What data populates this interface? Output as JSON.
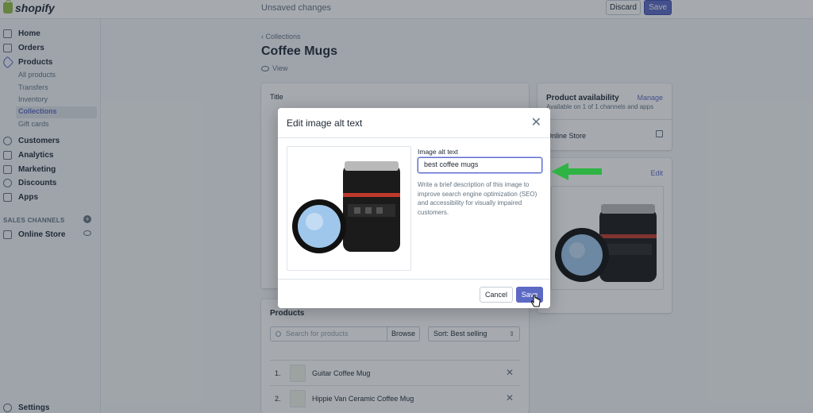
{
  "topbar": {
    "brand": "shopify",
    "status": "Unsaved changes",
    "discard_label": "Discard",
    "save_label": "Save"
  },
  "sidebar": {
    "items": [
      {
        "label": "Home",
        "icon": "home-icon"
      },
      {
        "label": "Orders",
        "icon": "orders-icon"
      },
      {
        "label": "Products",
        "icon": "tag-icon"
      }
    ],
    "product_subitems": [
      "All products",
      "Transfers",
      "Inventory",
      "Collections",
      "Gift cards"
    ],
    "active_subitem": "Collections",
    "items2": [
      {
        "label": "Customers",
        "icon": "person-icon"
      },
      {
        "label": "Analytics",
        "icon": "bar-chart-icon"
      },
      {
        "label": "Marketing",
        "icon": "megaphone-icon"
      },
      {
        "label": "Discounts",
        "icon": "discount-icon"
      },
      {
        "label": "Apps",
        "icon": "apps-icon"
      }
    ],
    "channels_title": "SALES CHANNELS",
    "channel": "Online Store",
    "settings": "Settings"
  },
  "page": {
    "back_link": "Collections",
    "title": "Coffee Mugs",
    "view_link": "View"
  },
  "main_card": {
    "title_label": "Title"
  },
  "products": {
    "title": "Products",
    "search_placeholder": "Search for products",
    "browse_label": "Browse",
    "sort_label": "Sort: Best selling",
    "rows": [
      {
        "num": "1.",
        "name": "Guitar Coffee Mug"
      },
      {
        "num": "2.",
        "name": "Hippie Van Ceramic Coffee Mug"
      }
    ]
  },
  "availability": {
    "title": "Product availability",
    "manage": "Manage",
    "desc": "Available on 1 of 1 channels and apps",
    "store": "Online Store"
  },
  "image_card": {
    "edit": "Edit"
  },
  "modal": {
    "title": "Edit image alt text",
    "alt_label": "Image alt text",
    "alt_value": "best coffee mugs",
    "help_text": "Write a brief description of this image to improve search engine optimization (SEO) and accessibility for visually impaired customers.",
    "cancel_label": "Cancel",
    "save_label": "Save"
  },
  "colors": {
    "accent": "#5c6ac4",
    "arrow": "#2fb344",
    "brand_green": "#95bf47"
  }
}
